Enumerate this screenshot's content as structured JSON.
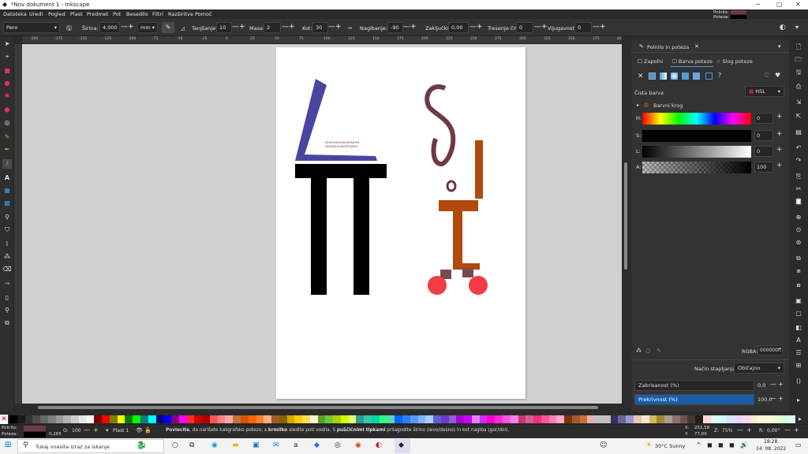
{
  "window": {
    "title": "*Nov dokument 1 - Inkscape",
    "controls": [
      "─",
      "□",
      "✕"
    ]
  },
  "menu": [
    "Datoteka",
    "Uredi",
    "Pogled",
    "Plast",
    "Predmet",
    "Pot",
    "Besedilo",
    "Filtri",
    "Razširitve",
    "Pomoč"
  ],
  "top_right": {
    "fill_label": "Polnilo:",
    "stroke_label": "Poteza:"
  },
  "toolctrl": {
    "preset": "Pero",
    "width_label": "Širina:",
    "width_value": "4,000",
    "unit": "mm",
    "thinning_label": "Tanjšanje:",
    "thinning_value": "10",
    "mass_label": "Masa:",
    "mass_value": "2",
    "angle_label": "Kot:",
    "angle_value": "30",
    "tilt_label": "Nagibanje:",
    "tilt_value": "-90",
    "caps_label": "Zaključki:",
    "caps_value": "0,00",
    "tremor_label": "Tresenje črt:",
    "tremor_value": "0",
    "wiggle_label": "Vijugavost:",
    "wiggle_value": "0"
  },
  "ruler_ticks": [
    "-200",
    "-175",
    "-150",
    "-125",
    "-100",
    "-75",
    "-50",
    "-25",
    "0",
    "25",
    "50",
    "75",
    "100",
    "125",
    "150",
    "175",
    "200",
    "225",
    "250",
    "275",
    "300",
    "325",
    "350",
    "375",
    "400"
  ],
  "canvas": {
    "text_line1": "JSHSHHHHDWSHEKJHFK",
    "text_line2": "JSBGRKJHGKJEHTKJERH",
    "colors": {
      "blue": "#4a46a0",
      "black": "#000000",
      "maroon": "#6e3a44",
      "orange": "#b14a0c",
      "red": "#f03c44",
      "brown": "#7a4a4a"
    }
  },
  "panel": {
    "title": "Polnilo in poteza",
    "tabs": [
      "Zapolni",
      "Barva poteze",
      "Slog poteze"
    ],
    "flat_color": "Čista barva",
    "mode": "HSL",
    "wheel": "Barvni krog",
    "h_label": "H:",
    "h_value": "0",
    "s_label": "S:",
    "s_value": "0",
    "l_label": "L:",
    "l_value": "0",
    "a_label": "A:",
    "a_value": "100",
    "rgba_label": "RGBA:",
    "rgba_value": "000000ff",
    "blend_label": "Način stapljanja:",
    "blend_value": "Običajno",
    "blur_label": "Zabrisanost (%)",
    "blur_value": "0,0",
    "opacity_label": "Prekrivnost (%)",
    "opacity_value": "100,0"
  },
  "palette_colors": [
    "#000000",
    "#1a1a1a",
    "#333333",
    "#4d4d4d",
    "#666666",
    "#808080",
    "#999999",
    "#b3b3b3",
    "#cccccc",
    "#e6e6e6",
    "#ffffff",
    "#800000",
    "#ff0000",
    "#808000",
    "#ffff00",
    "#008000",
    "#00ff00",
    "#008080",
    "#00ffff",
    "#000080",
    "#0000ff",
    "#800080",
    "#ff00ff",
    "#ff2a2a",
    "#d40000",
    "#aa0000",
    "#ff5555",
    "#ff8080",
    "#ffaaaa",
    "#c87137",
    "#d45500",
    "#ff6600",
    "#ff7f2a",
    "#ffb380",
    "#a05a2c",
    "#806600",
    "#d4aa00",
    "#ffcc00",
    "#ffdd55",
    "#fff6d5",
    "#5aa02c",
    "#71c837",
    "#aad400",
    "#ccff00",
    "#e5ff80",
    "#2ca089",
    "#37c8ab",
    "#00d4aa",
    "#2aff80",
    "#5fd3bc",
    "#0066ff",
    "#2a7fff",
    "#5599ff",
    "#80b3ff",
    "#aaccff",
    "#5f5fd3",
    "#7137c8",
    "#8d5fd3",
    "#aa00d4",
    "#cc00ff",
    "#e580ff",
    "#d42aff",
    "#ff00cc",
    "#ff2ad4",
    "#ff55dd",
    "#ff80e5",
    "#c83771",
    "#d35f8d",
    "#ff2a7f",
    "#ff5599",
    "#ff80b2",
    "#ffaacc",
    "#803300",
    "#a05a2c",
    "#c87137",
    "#e9afaf",
    "#b7c4c8",
    "#c8beb7",
    "#333366",
    "#666699",
    "#9999cc",
    "#e9c6af",
    "#f4e3d7",
    "#d3bc5f",
    "#a0892c",
    "#ac9d93",
    "#916f6f",
    "#6c5353",
    "#483737",
    "#241c1c",
    "#ffd5d5",
    "#d5ffe6",
    "#d5f6ff",
    "#d5e5ff",
    "#e5d5ff",
    "#ffd5f6",
    "#ffe6d5",
    "#fff6d5",
    "#f6ffd5",
    "#e6ffd5",
    "#d5ffd5",
    "#d5fff6"
  ],
  "status": {
    "fill_label": "Polnilo:",
    "stroke_label": "Poteza:",
    "stroke_width": "0,265",
    "opacity_label": "O:",
    "opacity_value": "100",
    "layer": "Plast 1",
    "message_bold1": "Povlecite",
    "message_part1": ", da narišete kaligrafsko potezo; s ",
    "message_bold2": "krmilko",
    "message_part2": " sledite poti vodila. S ",
    "message_bold3": "puščičnimi tipkami",
    "message_part3": " prilagodite širino (levo/desno) in kot nagiba (gor/dol).",
    "x_label": "X:",
    "x_value": "251,58",
    "y_label": "Y:",
    "y_value": "77,00",
    "zoom_label": "Z:",
    "zoom_value": "75%",
    "rot_label": "R:",
    "rot_value": "0,00°"
  },
  "taskbar": {
    "search_placeholder": "Tukaj vnesite izraz za iskanje",
    "weather": "30°C  Sunny",
    "time": "18:28",
    "date": "14. 08. 2022"
  }
}
